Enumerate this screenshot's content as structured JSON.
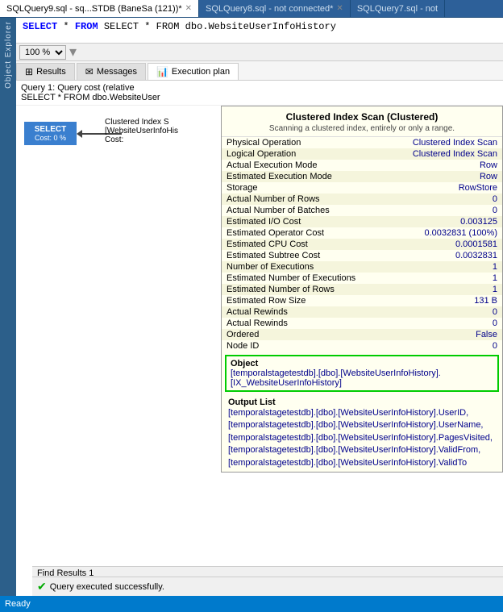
{
  "tabs": [
    {
      "label": "SQLQuery9.sql - sq...STDB (BaneSa (121))*",
      "active": true,
      "closable": true
    },
    {
      "label": "SQLQuery8.sql - not connected*",
      "active": false,
      "closable": true
    },
    {
      "label": "SQLQuery7.sql - not",
      "active": false,
      "closable": false
    }
  ],
  "editor": {
    "sql": "SELECT * FROM dbo.WebsiteUserInfoHistory"
  },
  "toolbar": {
    "zoom": "100 %"
  },
  "result_tabs": [
    {
      "label": "Results",
      "active": false
    },
    {
      "label": "Messages",
      "active": false
    },
    {
      "label": "Execution plan",
      "active": true
    }
  ],
  "query_info": {
    "line1": "Query 1: Query cost (relative",
    "line2": "SELECT * FROM dbo.WebsiteUser"
  },
  "select_node": {
    "label": "SELECT",
    "cost": "Cost: 0 %"
  },
  "index_node": {
    "label": "Clustered Index S",
    "sublabel": "[WebsiteUserInfoHis",
    "cost_label": "Cost:",
    "cost_value": ""
  },
  "tooltip": {
    "title": "Clustered Index Scan (Clustered)",
    "subtitle": "Scanning a clustered index, entirely or only a range.",
    "rows": [
      {
        "label": "Physical Operation",
        "value": "Clustered Index Scan"
      },
      {
        "label": "Logical Operation",
        "value": "Clustered Index Scan"
      },
      {
        "label": "Actual Execution Mode",
        "value": "Row"
      },
      {
        "label": "Estimated Execution Mode",
        "value": "Row"
      },
      {
        "label": "Storage",
        "value": "RowStore"
      },
      {
        "label": "Actual Number of Rows",
        "value": "0"
      },
      {
        "label": "Actual Number of Batches",
        "value": "0"
      },
      {
        "label": "Estimated I/O Cost",
        "value": "0.003125"
      },
      {
        "label": "Estimated Operator Cost",
        "value": "0.0032831 (100%)"
      },
      {
        "label": "Estimated CPU Cost",
        "value": "0.0001581"
      },
      {
        "label": "Estimated Subtree Cost",
        "value": "0.0032831"
      },
      {
        "label": "Number of Executions",
        "value": "1"
      },
      {
        "label": "Estimated Number of Executions",
        "value": "1"
      },
      {
        "label": "Estimated Number of Rows",
        "value": "1"
      },
      {
        "label": "Estimated Row Size",
        "value": "131 B"
      },
      {
        "label": "Actual Rewinds",
        "value": "0"
      },
      {
        "label": "Actual Rewinds",
        "value": "0"
      },
      {
        "label": "Ordered",
        "value": "False"
      },
      {
        "label": "Node ID",
        "value": "0"
      }
    ],
    "object_label": "Object",
    "object_value": "[temporalstagetestdb].[dbo].[WebsiteUserInfoHistory].[IX_WebsiteUserInfoHistory]",
    "output_label": "Output List",
    "output_value": "[temporalstagetestdb].[dbo].[WebsiteUserInfoHistory].UserID, [temporalstagetestdb].[dbo].[WebsiteUserInfoHistory].UserName, [temporalstagetestdb].[dbo].[WebsiteUserInfoHistory].PagesVisited, [temporalstagetestdb].[dbo].[WebsiteUserInfoHistory].ValidFrom, [temporalstagetestdb].[dbo].[WebsiteUserInfoHistory].ValidTo"
  },
  "success_message": "Query executed successfully.",
  "find_results": "Find Results 1",
  "status_bar": "Ready",
  "sidebar_label": "Object Explorer"
}
